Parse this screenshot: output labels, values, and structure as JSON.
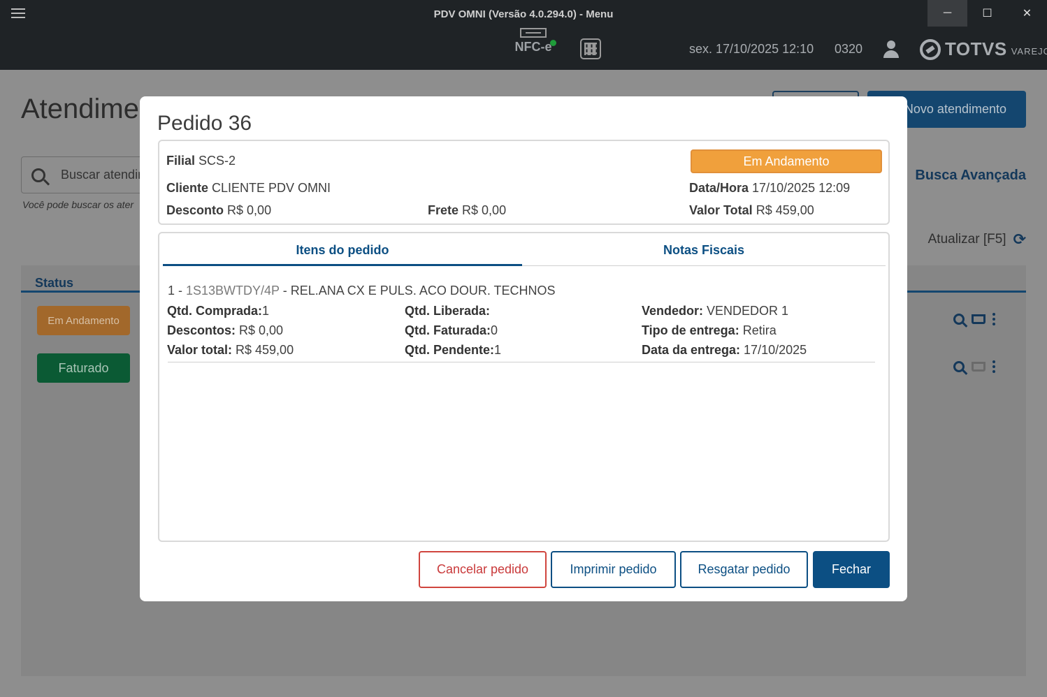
{
  "window": {
    "title": "PDV OMNI (Versão 4.0.294.0) - Menu",
    "controls": [
      "─",
      "☐",
      "✕"
    ]
  },
  "header": {
    "nfce_label": "NFC-e",
    "nfce_status_color": "#1f9d3a",
    "datetime": "sex. 17/10/2025 12:10",
    "operator_code": "0320",
    "brand_name": "TOTVS",
    "brand_sub": "VAREJO"
  },
  "background_page": {
    "title": "Atendime",
    "new_button": "Novo atendimento",
    "search_placeholder": "Buscar atendir",
    "search_hint": "Você pode buscar os ater",
    "advanced_search": "Busca Avançada",
    "refresh": "Atualizar [F5]",
    "status_header": "Status",
    "rows": [
      {
        "status": "Em Andamento"
      },
      {
        "status": "Faturado"
      }
    ]
  },
  "modal": {
    "title": "Pedido 36",
    "status": "Em Andamento",
    "status_color": "#f0a03c",
    "filial_label": "Filial",
    "filial": "SCS-2",
    "cliente_label": "Cliente",
    "cliente": "CLIENTE PDV OMNI",
    "datahora_label": "Data/Hora",
    "datahora": "17/10/2025 12:09",
    "desconto_label": "Desconto",
    "desconto": "R$ 0,00",
    "frete_label": "Frete",
    "frete": "R$ 0,00",
    "valor_total_label": "Valor Total",
    "valor_total": "R$ 459,00",
    "tabs": [
      "Itens do pedido",
      "Notas Fiscais"
    ],
    "item": {
      "index": "1 - ",
      "code": "1S13BWTDY/4P",
      "description": " - REL.ANA CX E PULS. ACO DOUR. TECHNOS",
      "qtd_comprada_label": "Qtd. Comprada:",
      "qtd_comprada": "1",
      "descontos_label": "Descontos:",
      "descontos": " R$ 0,00",
      "valor_total_label": "Valor total:",
      "valor_total": " R$ 459,00",
      "qtd_liberada_label": "Qtd. Liberada:",
      "qtd_liberada": "",
      "qtd_faturada_label": "Qtd. Faturada:",
      "qtd_faturada": "0",
      "qtd_pendente_label": "Qtd. Pendente:",
      "qtd_pendente": "1",
      "vendedor_label": "Vendedor:",
      "vendedor": " VENDEDOR 1",
      "tipo_entrega_label": "Tipo de entrega:",
      "tipo_entrega": " Retira",
      "data_entrega_label": "Data da entrega:",
      "data_entrega": " 17/10/2025"
    },
    "buttons": {
      "cancel": "Cancelar pedido",
      "print": "Imprimir pedido",
      "rescue": "Resgatar pedido",
      "close": "Fechar"
    }
  }
}
